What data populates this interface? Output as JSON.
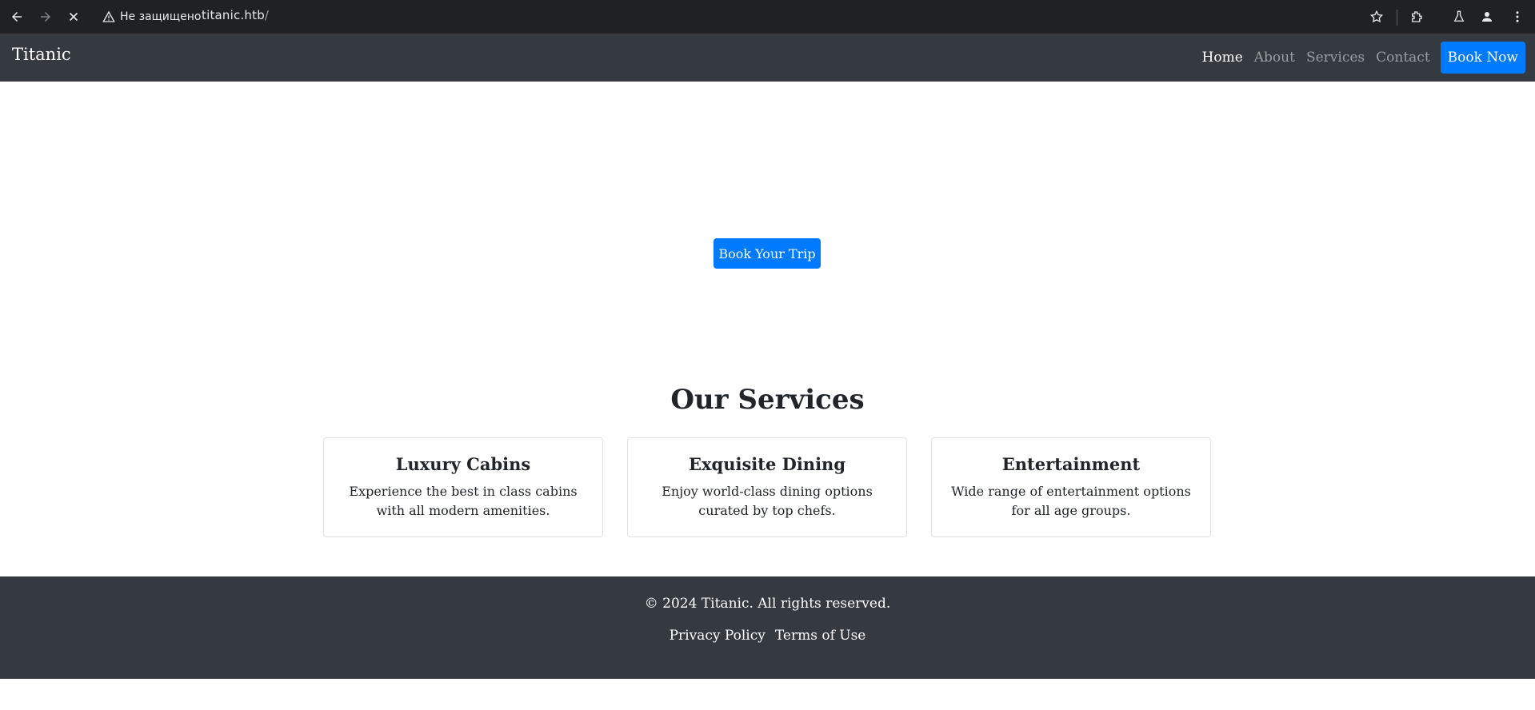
{
  "browser": {
    "back_icon": "arrow-left-icon",
    "forward_icon": "arrow-right-icon",
    "stop_icon": "close-icon",
    "security_label": "Не защищено",
    "url_host": "titanic.htb",
    "url_path": "/"
  },
  "navbar": {
    "brand": "Titanic",
    "links": [
      "Home",
      "About",
      "Services",
      "Contact"
    ],
    "cta": "Book Now"
  },
  "hero": {
    "button": "Book Your Trip"
  },
  "services": {
    "title": "Our Services",
    "cards": [
      {
        "title": "Luxury Cabins",
        "text": "Experience the best in class cabins with all modern amenities."
      },
      {
        "title": "Exquisite Dining",
        "text": "Enjoy world-class dining options curated by top chefs."
      },
      {
        "title": "Entertainment",
        "text": "Wide range of entertainment options for all age groups."
      }
    ]
  },
  "footer": {
    "copyright": "© 2024 Titanic. All rights reserved.",
    "links": [
      "Privacy Policy",
      "Terms of Use"
    ]
  },
  "colors": {
    "primary": "#007bff",
    "dark": "#343a40",
    "chrome": "#202124"
  }
}
